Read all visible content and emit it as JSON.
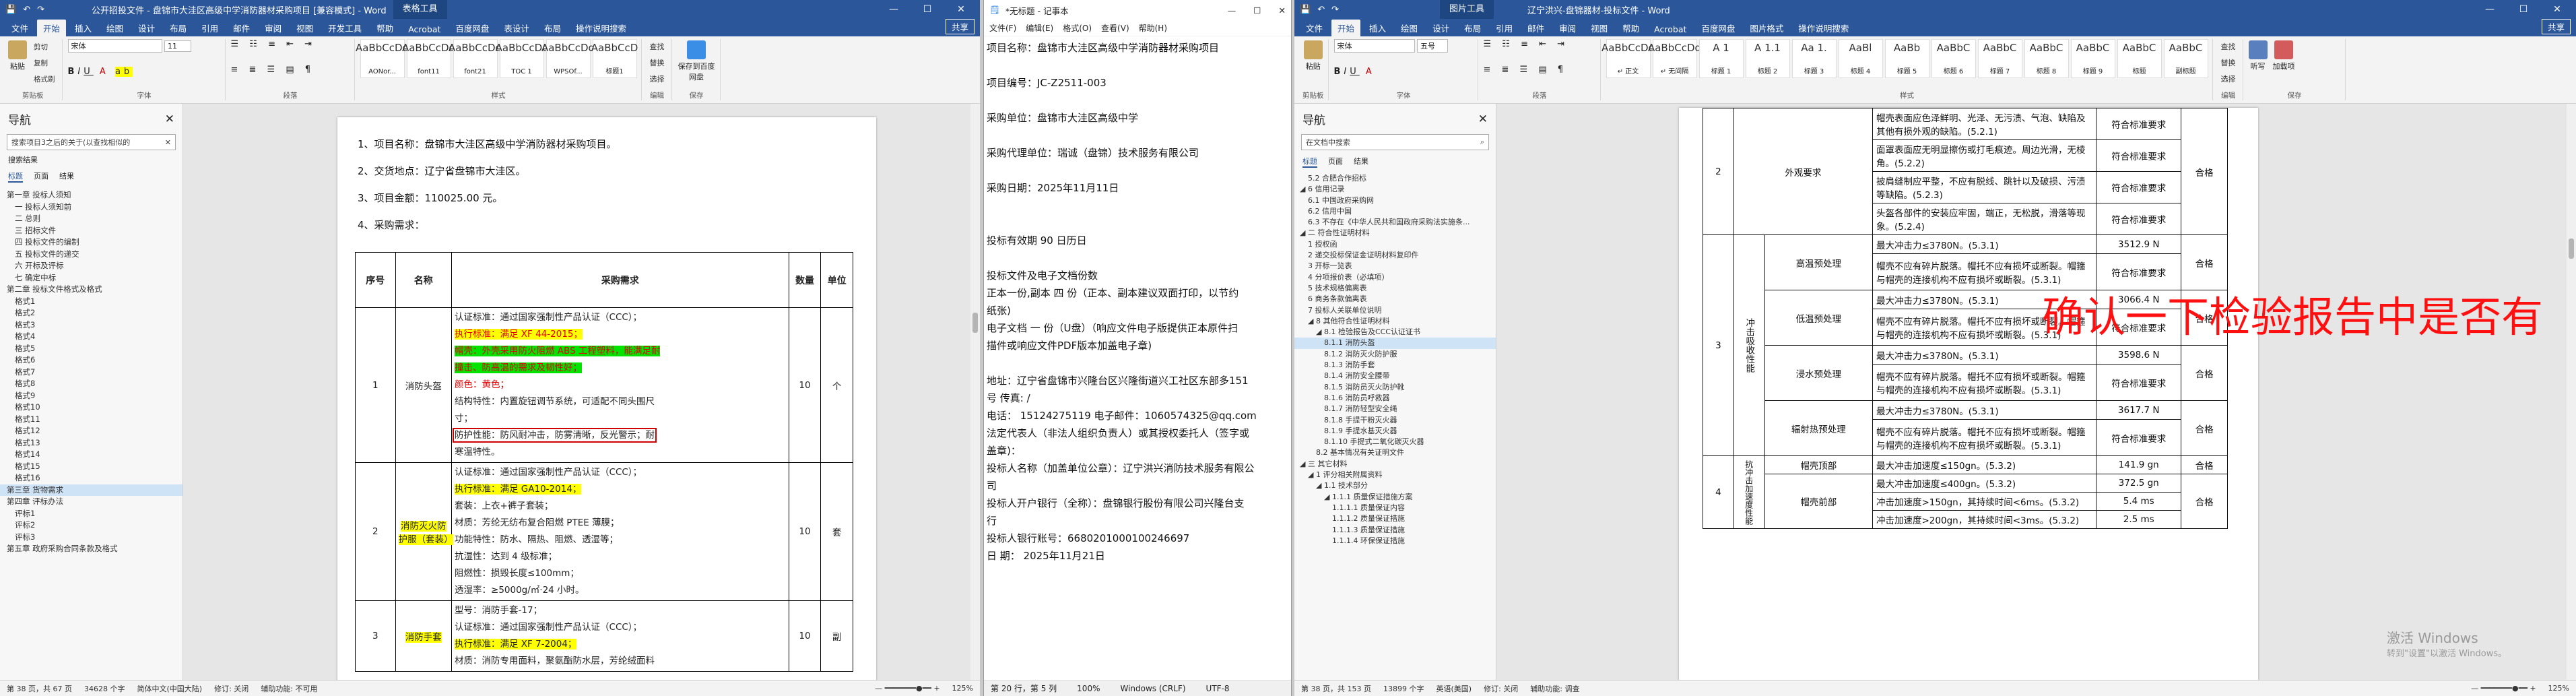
{
  "win1": {
    "titlebar": {
      "doc": "公开招投文件 - 盘锦市大洼区高级中学消防器材采购项目 [兼容模式] - Word",
      "ctx": "表格工具",
      "controls": [
        "—",
        "☐",
        "✕"
      ]
    },
    "menu": [
      "文件",
      "开始",
      "插入",
      "绘图",
      "设计",
      "布局",
      "引用",
      "邮件",
      "审阅",
      "视图",
      "开发工具",
      "帮助",
      "Acrobat",
      "百度网盘",
      "表设计",
      "布局",
      "操作说明搜索"
    ],
    "active_menu": "开始",
    "share": "共享",
    "ribbon": {
      "font": "宋体",
      "size": "11",
      "styles": [
        "AaBbCcDd",
        "AaBbCcDd",
        "AaBbCcDd",
        "AaBbCcDc",
        "AaBbCcDd",
        "AaBbCcD"
      ],
      "style_names": [
        "AONor...",
        "font11",
        "font21",
        "TOC 1",
        "WPSOf...",
        "标题1"
      ],
      "groups": [
        "剪贴板",
        "字体",
        "段落",
        "样式",
        "编辑",
        "保存"
      ],
      "paste": "粘贴",
      "cut": "剪切",
      "copy": "复制",
      "painter": "格式刷",
      "find": "查找",
      "replace": "替换",
      "select": "选择",
      "save": "保存到百度网盘"
    },
    "nav": {
      "title": "导航",
      "search": "搜索项目3之后的关于(以查找相似的",
      "search_sub": "搜索结果",
      "tabs": [
        "标题",
        "页面",
        "结果"
      ],
      "items": [
        "第一章 投标人须知",
        "一 投标人须知前",
        "二 总则",
        "三 招标文件",
        "四 投标文件的编制",
        "五 投标文件的递交",
        "六 开标及评标",
        "七 确定中标",
        "第二章 投标文件格式及格式",
        "格式1",
        "格式2",
        "格式3",
        "格式4",
        "格式5",
        "格式6",
        "格式7",
        "格式8",
        "格式9",
        "格式10",
        "格式11",
        "格式12",
        "格式13",
        "格式14",
        "格式15",
        "格式16",
        "第三章 货物需求",
        "第四章 评标办法",
        "评标1",
        "评标2",
        "评标3",
        "第五章 政府采购合同条款及格式"
      ],
      "selected": 25
    },
    "doc": {
      "items": [
        "1、项目名称：盘锦市大洼区高级中学消防器材采购项目。",
        "2、交货地点：辽宁省盘锦市大洼区。",
        "3、项目金额：110025.00 元。",
        "4、采购需求："
      ],
      "cols": [
        "序号",
        "名称",
        "采购需求",
        "数量",
        "单位"
      ],
      "rows": [
        {
          "no": "1",
          "name": "消防头盔",
          "qty": "10",
          "unit": "个",
          "lines": [
            {
              "t": "认证标准：通过国家强制性产品认证（CCC）；",
              "s": ""
            },
            {
              "t": "执行标准：满足 XF 44-2015；",
              "s": "hly red"
            },
            {
              "t": "帽壳：外壳采用防火阻燃 ABS 工程塑料，能满足耐",
              "s": "hlg red"
            },
            {
              "t": "撞击、防高温的需求及韧性好；",
              "s": "hlg red"
            },
            {
              "t": "颜色：黄色；",
              "s": "red"
            },
            {
              "t": "结构特性：内置旋钮调节系统，可适配不同头围尺",
              "s": ""
            },
            {
              "t": "寸；",
              "s": ""
            },
            {
              "t": "防护性能：防风耐冲击，防雾清晰，反光警示；耐",
              "s": "box"
            },
            {
              "t": "寒温特性。",
              "s": ""
            }
          ]
        },
        {
          "no": "2",
          "name": "消防灭火防护服（套装）",
          "qty": "10",
          "unit": "套",
          "lines": [
            {
              "t": "认证标准：通过国家强制性产品认证（CCC）；",
              "s": ""
            },
            {
              "t": "执行标准：满足 GA10-2014；",
              "s": "hly"
            },
            {
              "t": "套装：上衣+裤子套装；",
              "s": ""
            },
            {
              "t": "材质：芳纶无纺布复合阻燃 PTEE 薄膜；",
              "s": ""
            },
            {
              "t": "功能特性：防水、隔热、阻燃、透湿等；",
              "s": ""
            },
            {
              "t": "抗湿性：达到 4 级标准；",
              "s": ""
            },
            {
              "t": "阻燃性：损毁长度≤100mm；",
              "s": ""
            },
            {
              "t": "透湿率：≥5000g/㎡·24 小时。",
              "s": ""
            }
          ]
        },
        {
          "no": "3",
          "name": "消防手套",
          "qty": "10",
          "unit": "副",
          "lines": [
            {
              "t": "型号：消防手套-17；",
              "s": ""
            },
            {
              "t": "认证标准：通过国家强制性产品认证（CCC）；",
              "s": ""
            },
            {
              "t": "执行标准：满足 XF 7-2004；",
              "s": "hly"
            },
            {
              "t": "材质：消防专用面料，聚氨酯防水层，芳纶绒面料",
              "s": ""
            }
          ]
        }
      ]
    },
    "status": {
      "page": "第 38 页，共 67 页",
      "words": "34628 个字",
      "lang": "简体中文(中国大陆)",
      "track": "修订: 关闭",
      "access": "辅助功能: 不可用",
      "zoom": "125%"
    }
  },
  "win2": {
    "title": "*无标题 - 记事本",
    "menu": [
      "文件(F)",
      "编辑(E)",
      "格式(O)",
      "查看(V)",
      "帮助(H)"
    ],
    "lines": [
      "项目名称：盘锦市大洼区高级中学消防器材采购项目",
      "",
      "项目编号：JC-Z2511-003",
      "",
      "采购单位：盘锦市大洼区高级中学",
      "",
      "采购代理单位：瑞诚（盘锦）技术服务有限公司",
      "",
      "采购日期：2025年11月11日",
      "",
      "",
      "投标有效期        90  日历日",
      "",
      "投标文件及电子文档份数",
      "正本一份,副本  四  份（正本、副本建议双面打印，以节约",
      "纸张)",
      "电子文档   一  份（U盘）（响应文件电子版提供正本原件扫",
      "描件或响应文件PDF版本加盖电子章)",
      "",
      "地址：辽宁省盘锦市兴隆台区兴隆街道兴工社区东部多151",
      "号          传真:      /",
      "电话： 15124275119    电子邮件：1060574325@qq.com",
      "法定代表人（非法人组织负责人）或其授权委托人（签字或",
      "盖章)：",
      "投标人名称（加盖单位公章）：辽宁洪兴消防技术服务有限公",
      "司",
      "投标人开户银行（全称）：盘锦银行股份有限公司兴隆台支",
      "行",
      "投标人银行账号：66802010001002466​97",
      "日    期：   2025年11月21日"
    ],
    "status": {
      "pos": "第 20 行，第 5 列",
      "zoom": "100%",
      "eol": "Windows (CRLF)",
      "enc": "UTF-8"
    }
  },
  "win3": {
    "titlebar": {
      "doc": "辽宁洪兴-盘锦器材-投标文件 - Word",
      "ctx": "图片工具",
      "controls": [
        "—",
        "☐",
        "✕"
      ]
    },
    "menu": [
      "文件",
      "开始",
      "插入",
      "绘图",
      "设计",
      "布局",
      "引用",
      "邮件",
      "审阅",
      "视图",
      "帮助",
      "Acrobat",
      "百度网盘",
      "图片格式",
      "操作说明搜索"
    ],
    "active_menu": "开始",
    "share": "共享",
    "ribbon": {
      "font": "宋体",
      "size": "五号",
      "styles": [
        "AaBbCcDd",
        "AaBbCcDd",
        "A 1",
        "A 1.1",
        "Aa 1.",
        "AaBl",
        "AaBb",
        "AaBbC",
        "AaBbC",
        "AaBbC",
        "AaBbC",
        "AaBbC",
        "AaBbC",
        "AaBb",
        "AaBbCc"
      ],
      "style_names": [
        "↵ 正文",
        "↵ 无间隔",
        "标题 1",
        "标题 2",
        "标题 3",
        "标题 4",
        "标题 5",
        "标题 6",
        "标题 7",
        "标题 8",
        "标题 9",
        "标题",
        "副标题"
      ],
      "groups": [
        "剪贴板",
        "字体",
        "段落",
        "样式",
        "编辑",
        "保存"
      ],
      "paste": "粘贴",
      "find": "查找",
      "replace": "替换",
      "select": "选择",
      "dictate": "听写",
      "addin": "加载项",
      "save": "保存到百度网盘"
    },
    "nav": {
      "title": "导航",
      "search": "在文档中搜索",
      "tabs": [
        "标题",
        "页面",
        "结果"
      ],
      "items": [
        "5.2 合肥合作招标",
        "◢ 6 信用记录",
        "6.1 中国政府采购网",
        "6.2 信用中国",
        "6.3 不存在《中华人民共和国政府采购法实施条...",
        "◢ 二 符合性证明材料",
        "1 授权函",
        "2 递交投标保证金证明材料复印件",
        "3 开标一览表",
        "4 分项报价表（必填项）",
        "5 技术规格偏离表",
        "6 商务条款偏离表",
        "7 投标人关联单位说明",
        "◢ 8 其他符合性证明材料",
        "◢ 8.1 检验报告及CCC认证证书",
        "8.1.1 消防头盔",
        "8.1.2 消防灭火防护服",
        "8.1.3 消防手套",
        "8.1.4 消防安全腰带",
        "8.1.5 消防员灭火防护靴",
        "8.1.6 消防员呼救器",
        "8.1.7 消防轻型安全绳",
        "8.1.8 手提干粉灭火器",
        "8.1.9 手提水基灭火器",
        "8.1.10 手提式二氧化碳灭火器",
        "8.2 基本情况有关证明文件",
        "◢ 三 其它材料",
        "◢ 1 评分相关附属资料",
        "◢ 1.1 技术部分",
        "◢ 1.1.1 质量保证措施方案",
        "1.1.1.1 质量保证内容",
        "1.1.1.2 质量保证措施",
        "1.1.1.3 质量保证措施",
        "1.1.1.4 环保保证措施"
      ],
      "selected": 15,
      "indent": [
        1,
        0,
        1,
        1,
        1,
        0,
        1,
        1,
        1,
        1,
        1,
        1,
        1,
        1,
        2,
        3,
        3,
        3,
        3,
        3,
        3,
        3,
        3,
        3,
        3,
        2,
        0,
        1,
        2,
        3,
        4,
        4,
        4,
        4
      ]
    },
    "table": {
      "rows": [
        {
          "no": "",
          "name": "",
          "req": "帽壳表面应色泽鲜明、光泽、无污渍、气泡、缺陷及其他有损外观的缺陷。(5.2.1)",
          "res": "符合标准要求",
          "judge": ""
        },
        {
          "no": "2",
          "name": "外观要求",
          "req": "面罩表面应无明显擦伤或打毛痕迹。周边光滑，无棱角。(5.2.2)",
          "res": "符合标准要求",
          "judge": "合格"
        },
        {
          "no": "",
          "name": "",
          "req": "披肩缝制应平整，不应有脱线、跳针以及破损、污渍等缺陷。(5.2.3)",
          "res": "符合标准要求",
          "judge": ""
        },
        {
          "no": "",
          "name": "",
          "req": "头盔各部件的安装应牢固，端正，无松脱，滑落等现象。(5.2.4)",
          "res": "符合标准要求",
          "judge": ""
        },
        {
          "no": "",
          "name": "高温预处理",
          "req": "最大冲击力≤3780N。(5.3.1)",
          "res": "3512.9 N",
          "judge": "合格"
        },
        {
          "no": "",
          "name": "",
          "req": "帽壳不应有碎片脱落。帽托不应有损坏或断裂。帽箍与帽壳的连接机构不应有损坏或断裂。(5.3.1)",
          "res": "符合标准要求",
          "judge": ""
        },
        {
          "no": "3",
          "name": "低温预处理",
          "req": "最大冲击力≤3780N。(5.3.1)",
          "res": "3066.4 N",
          "judge": "合格"
        },
        {
          "no": "",
          "name": "",
          "req": "帽壳不应有碎片脱落。帽托不应有损坏或断裂。帽箍与帽壳的连接机构不应有损坏或断裂。(5.3.1)",
          "res": "符合标准要求",
          "judge": ""
        },
        {
          "no": "",
          "name": "浸水预处理",
          "req": "最大冲击力≤3780N。(5.3.1)",
          "res": "3598.6 N",
          "judge": "合格"
        },
        {
          "no": "",
          "name": "",
          "req": "帽壳不应有碎片脱落。帽托不应有损坏或断裂。帽箍与帽壳的连接机构不应有损坏或断裂。(5.3.1)",
          "res": "符合标准要求",
          "judge": ""
        },
        {
          "no": "",
          "name": "辐射热预处理",
          "req": "最大冲击力≤3780N。(5.3.1)",
          "res": "3617.7 N",
          "judge": "合格"
        },
        {
          "no": "",
          "name": "",
          "req": "帽壳不应有碎片脱落。帽托不应有损坏或断裂。帽箍与帽壳的连接机构不应有损坏或断裂。(5.3.1)",
          "res": "符合标准要求",
          "judge": ""
        },
        {
          "no": "4",
          "name": "帽壳顶部",
          "req": "最大冲击加速度≤150gn。(5.3.2)",
          "res": "141.9 gn",
          "judge": "合格"
        },
        {
          "no": "",
          "name": "帽壳前部",
          "req": "最大冲击加速度≤400gn。(5.3.2)",
          "res": "372.5 gn",
          "judge": "合格"
        },
        {
          "no": "",
          "name": "",
          "req": "冲击加速度>150gn，其持续时间<6ms。(5.3.2)",
          "res": "5.4 ms",
          "judge": ""
        },
        {
          "no": "",
          "name": "",
          "req": "冲击加速度>200gn，其持续时间<3ms。(5.3.2)",
          "res": "2.5 ms",
          "judge": ""
        }
      ],
      "group3": "冲击吸收性能",
      "group4": "抗冲击加速度性能"
    },
    "overlay": "确认一下检验报告中是否有",
    "watermark": [
      "激活 Windows",
      "转到\"设置\"以激活 Windows。"
    ],
    "status": {
      "page": "第 38 页，共 153 页",
      "words": "13899 个字",
      "lang": "英语(美国)",
      "track": "修订: 关闭",
      "access": "辅助功能: 调查",
      "zoom": "125%"
    }
  },
  "colors": {
    "word_blue": "#2b579a",
    "highlight_yellow": "#ffff00",
    "highlight_green": "#00e400",
    "overlay_red": "#ff1010"
  }
}
